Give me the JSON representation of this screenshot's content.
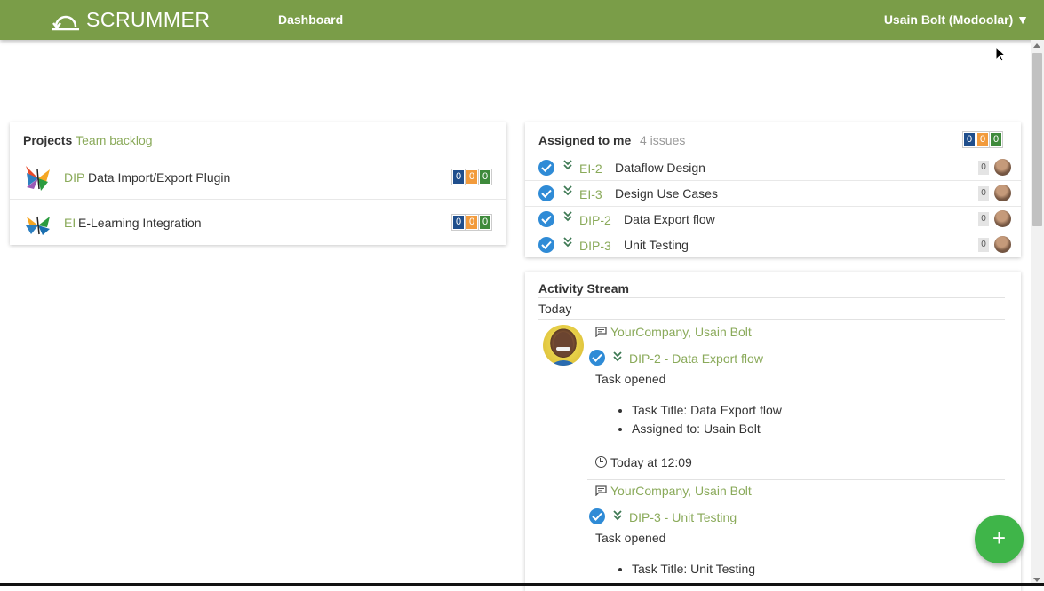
{
  "header": {
    "brand": "SCRUMMER",
    "nav_dashboard": "Dashboard",
    "user_menu": "Usain Bolt (Modoolar) ▼",
    "bg_color": "#7a9d48"
  },
  "projects": {
    "title": "Projects",
    "title_link": "Team backlog",
    "items": [
      {
        "key": "DIP",
        "name": "Data Import/Export Plugin",
        "counts": [
          "0",
          "0",
          "0"
        ]
      },
      {
        "key": "EI",
        "name": "E-Learning Integration",
        "counts": [
          "0",
          "0",
          "0"
        ]
      }
    ]
  },
  "assigned": {
    "title": "Assigned to me",
    "issues_count": "4 issues",
    "counts": [
      "0",
      "0",
      "0"
    ],
    "issues": [
      {
        "key": "EI-2",
        "title": "Dataflow Design",
        "comments": "0"
      },
      {
        "key": "EI-3",
        "title": "Design Use Cases",
        "comments": "0"
      },
      {
        "key": "DIP-2",
        "title": "Data Export flow",
        "comments": "0"
      },
      {
        "key": "DIP-3",
        "title": "Unit Testing",
        "comments": "0"
      }
    ]
  },
  "activity": {
    "title": "Activity Stream",
    "day": "Today",
    "entries": [
      {
        "company": "YourCompany, Usain Bolt",
        "issue": "DIP-2 - Data Export flow",
        "action": "Task opened",
        "details": [
          "Task Title: Data Export flow",
          "Assigned to: Usain Bolt"
        ],
        "time": "Today at 12:09"
      },
      {
        "company": "YourCompany, Usain Bolt",
        "issue": "DIP-3 - Unit Testing",
        "action": "Task opened",
        "details": [
          "Task Title: Unit Testing"
        ]
      }
    ]
  },
  "fab_label": "+",
  "colors": {
    "accent_green": "#8aaa5a",
    "count_blue": "#1f4e8c",
    "count_orange": "#f29b3c",
    "count_green": "#3e8a3b",
    "check_blue": "#2f8bd6",
    "fab_green": "#3fb549"
  }
}
